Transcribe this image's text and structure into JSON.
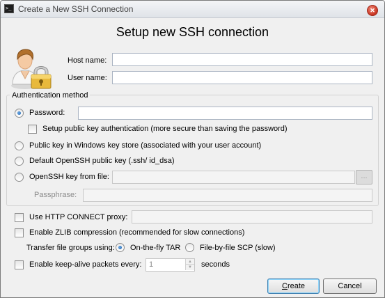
{
  "window": {
    "title": "Create a New SSH Connection",
    "icon": "terminal-icon"
  },
  "heading": "Setup new SSH connection",
  "host": {
    "label": "Host name:",
    "value": ""
  },
  "user": {
    "label": "User name:",
    "value": ""
  },
  "auth": {
    "legend": "Authentication method",
    "password": {
      "label": "Password:",
      "checked": true,
      "value": ""
    },
    "setup_pubkey": {
      "label": "Setup public key authentication (more secure than saving the password)",
      "checked": false
    },
    "win_store": {
      "label": "Public key in Windows key store (associated with your user account)"
    },
    "default_key": {
      "label": "Default OpenSSH public key (.ssh/ id_dsa)"
    },
    "key_file": {
      "label": "OpenSSH key from file:",
      "value": "",
      "browse_label": "..."
    },
    "passphrase": {
      "label": "Passphrase:",
      "value": ""
    }
  },
  "http_proxy": {
    "label": "Use HTTP CONNECT proxy:",
    "checked": false,
    "value": ""
  },
  "zlib": {
    "label": "Enable ZLIB compression (recommended for slow connections)",
    "checked": false
  },
  "transfer": {
    "label": "Transfer file groups using:",
    "options": [
      "On-the-fly TAR",
      "File-by-file SCP (slow)"
    ],
    "selected": "On-the-fly TAR"
  },
  "keepalive": {
    "label": "Enable keep-alive packets every:",
    "checked": false,
    "value": "1",
    "unit": "seconds"
  },
  "buttons": {
    "create": "Create",
    "cancel": "Cancel"
  }
}
